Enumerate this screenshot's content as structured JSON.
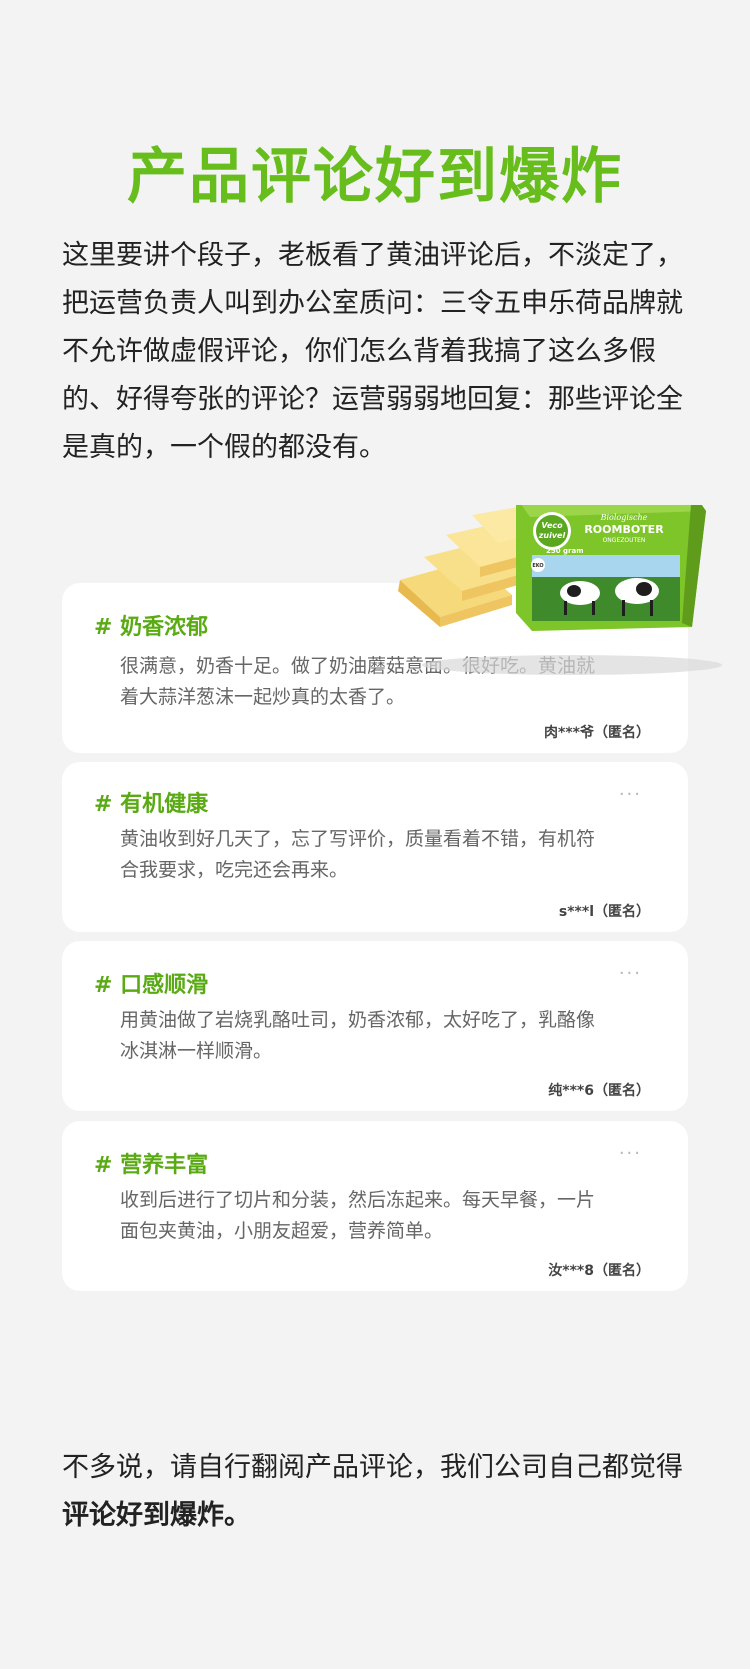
{
  "title": "产品评论好到爆炸",
  "intro": "这里要讲个段子，老板看了黄油评论后，不淡定了，\n把运营负责人叫到办公室质问：三令五申乐荷品牌就\n不允许做虚假评论，你们怎么背着我搞了这么多假\n的、好得夸张的评论？运营弱弱地回复：那些评论全\n是真的，一个假的都没有。",
  "product": {
    "brand_line1": "Veco",
    "brand_line2": "zuivel",
    "name_top": "Biologische",
    "name_main": "ROOMBOTER",
    "name_sub": "ONGEZOUTEN",
    "weight": "250 gram",
    "eco": "EKO"
  },
  "reviews": [
    {
      "tag": "# 奶香浓郁",
      "text": "很满意，奶香十足。做了奶油蘑菇意面。很好吃。黄油就\n着大蒜洋葱沫一起炒真的太香了。",
      "user": "肉***爷（匿名）",
      "dots": ""
    },
    {
      "tag": "# 有机健康",
      "text": "黄油收到好几天了，忘了写评价，质量看着不错，有机符\n合我要求，吃完还会再来。",
      "user": "s***l（匿名）",
      "dots": "···"
    },
    {
      "tag": "# 口感顺滑",
      "text": "用黄油做了岩烧乳酪吐司，奶香浓郁，太好吃了，乳酪像\n冰淇淋一样顺滑。",
      "user": "纯***6（匿名）",
      "dots": "···"
    },
    {
      "tag": "# 营养丰富",
      "text": "收到后进行了切片和分装，然后冻起来。每天早餐，一片\n面包夹黄油，小朋友超爱，营养简单。",
      "user": "汝***8（匿名）",
      "dots": "···"
    }
  ],
  "outro": {
    "line1": "不多说，请自行翻阅产品评论，我们公司自己都觉得",
    "line2_bold": "评论好到爆炸。"
  },
  "colors": {
    "accent": "#66bd1c",
    "tag": "#5aaa14",
    "background": "#f3f3f3",
    "card": "#ffffff"
  }
}
